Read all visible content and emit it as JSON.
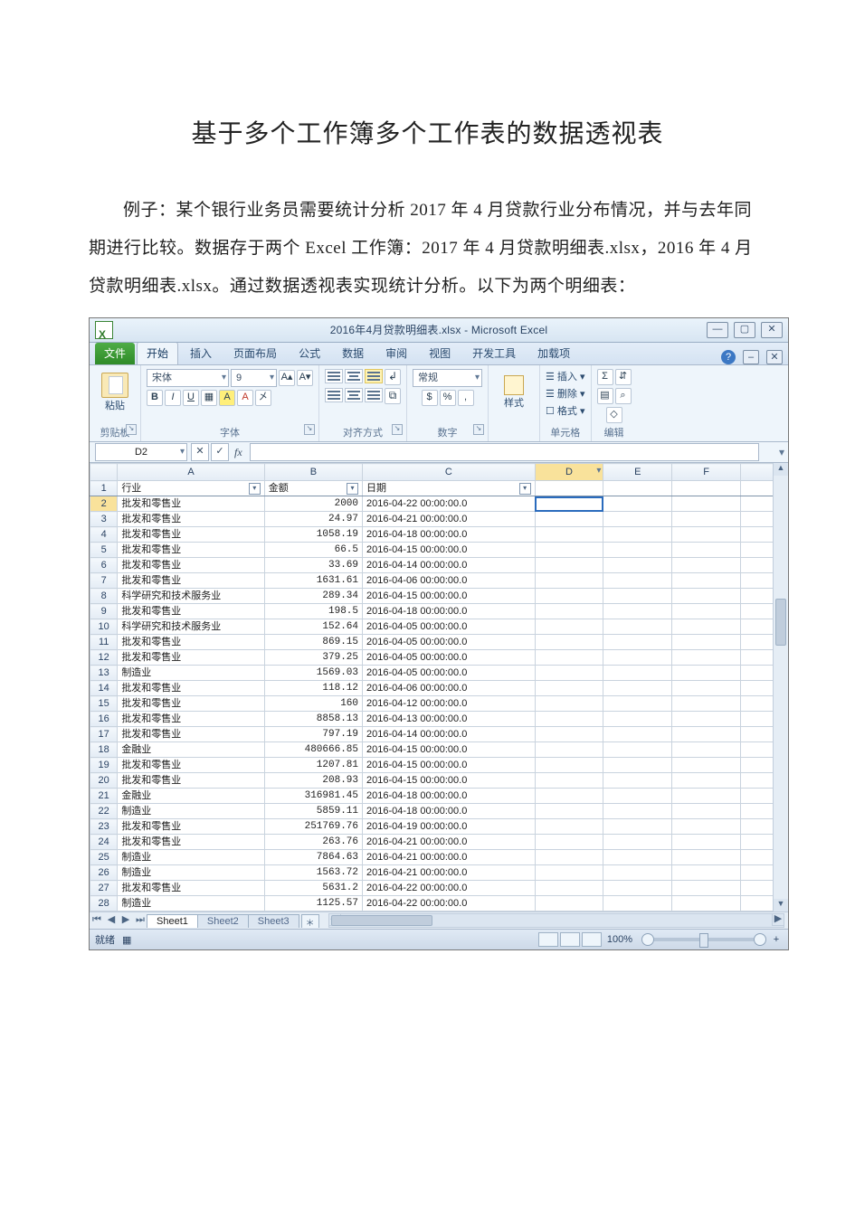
{
  "doc": {
    "title": "基于多个工作簿多个工作表的数据透视表",
    "para": "例子：某个银行业务员需要统计分析 2017 年 4 月贷款行业分布情况，并与去年同期进行比较。数据存于两个 Excel 工作簿：2017 年 4 月贷款明细表.xlsx，2016 年 4 月贷款明细表.xlsx。通过数据透视表实现统计分析。以下为两个明细表："
  },
  "excel": {
    "titlebar": "2016年4月贷款明细表.xlsx - Microsoft Excel",
    "winbtns": {
      "min": "—",
      "max": "▢",
      "close": "✕"
    },
    "tabs": {
      "file": "文件",
      "home": "开始",
      "insert": "插入",
      "layout": "页面布局",
      "formulas": "公式",
      "data": "数据",
      "review": "审阅",
      "view": "视图",
      "dev": "开发工具",
      "addins": "加载项"
    },
    "ribbon": {
      "clipboard": {
        "paste": "粘贴",
        "group": "剪贴板"
      },
      "font": {
        "name": "宋体",
        "size": "9",
        "bold": "B",
        "italic": "I",
        "underline": "U",
        "ruby": "㐅",
        "group": "字体"
      },
      "align": {
        "group": "对齐方式"
      },
      "number": {
        "format": "常规",
        "group": "数字"
      },
      "styles": {
        "label": "样式"
      },
      "cells": {
        "insert": "插入",
        "delete": "删除",
        "format": "格式",
        "group": "单元格"
      },
      "editing": {
        "sum": "Σ",
        "sort": "⇵",
        "find": "⌕",
        "group": "编辑"
      }
    },
    "formula": {
      "namebox": "D2",
      "fx": "fx"
    },
    "columns": [
      "A",
      "B",
      "C",
      "D",
      "E",
      "F"
    ],
    "headers": {
      "A": "行业",
      "B": "金额",
      "C": "日期"
    },
    "rows": [
      {
        "n": 2,
        "a": "批发和零售业",
        "b": "2000",
        "c": "2016-04-22 00:00:00.0"
      },
      {
        "n": 3,
        "a": "批发和零售业",
        "b": "24.97",
        "c": "2016-04-21 00:00:00.0"
      },
      {
        "n": 4,
        "a": "批发和零售业",
        "b": "1058.19",
        "c": "2016-04-18 00:00:00.0"
      },
      {
        "n": 5,
        "a": "批发和零售业",
        "b": "66.5",
        "c": "2016-04-15 00:00:00.0"
      },
      {
        "n": 6,
        "a": "批发和零售业",
        "b": "33.69",
        "c": "2016-04-14 00:00:00.0"
      },
      {
        "n": 7,
        "a": "批发和零售业",
        "b": "1631.61",
        "c": "2016-04-06 00:00:00.0"
      },
      {
        "n": 8,
        "a": "科学研究和技术服务业",
        "b": "289.34",
        "c": "2016-04-15 00:00:00.0"
      },
      {
        "n": 9,
        "a": "批发和零售业",
        "b": "198.5",
        "c": "2016-04-18 00:00:00.0"
      },
      {
        "n": 10,
        "a": "科学研究和技术服务业",
        "b": "152.64",
        "c": "2016-04-05 00:00:00.0"
      },
      {
        "n": 11,
        "a": "批发和零售业",
        "b": "869.15",
        "c": "2016-04-05 00:00:00.0"
      },
      {
        "n": 12,
        "a": "批发和零售业",
        "b": "379.25",
        "c": "2016-04-05 00:00:00.0"
      },
      {
        "n": 13,
        "a": "制造业",
        "b": "1569.03",
        "c": "2016-04-05 00:00:00.0"
      },
      {
        "n": 14,
        "a": "批发和零售业",
        "b": "118.12",
        "c": "2016-04-06 00:00:00.0"
      },
      {
        "n": 15,
        "a": "批发和零售业",
        "b": "160",
        "c": "2016-04-12 00:00:00.0"
      },
      {
        "n": 16,
        "a": "批发和零售业",
        "b": "8858.13",
        "c": "2016-04-13 00:00:00.0"
      },
      {
        "n": 17,
        "a": "批发和零售业",
        "b": "797.19",
        "c": "2016-04-14 00:00:00.0"
      },
      {
        "n": 18,
        "a": "金融业",
        "b": "480666.85",
        "c": "2016-04-15 00:00:00.0"
      },
      {
        "n": 19,
        "a": "批发和零售业",
        "b": "1207.81",
        "c": "2016-04-15 00:00:00.0"
      },
      {
        "n": 20,
        "a": "批发和零售业",
        "b": "208.93",
        "c": "2016-04-15 00:00:00.0"
      },
      {
        "n": 21,
        "a": "金融业",
        "b": "316981.45",
        "c": "2016-04-18 00:00:00.0"
      },
      {
        "n": 22,
        "a": "制造业",
        "b": "5859.11",
        "c": "2016-04-18 00:00:00.0"
      },
      {
        "n": 23,
        "a": "批发和零售业",
        "b": "251769.76",
        "c": "2016-04-19 00:00:00.0"
      },
      {
        "n": 24,
        "a": "批发和零售业",
        "b": "263.76",
        "c": "2016-04-21 00:00:00.0"
      },
      {
        "n": 25,
        "a": "制造业",
        "b": "7864.63",
        "c": "2016-04-21 00:00:00.0"
      },
      {
        "n": 26,
        "a": "制造业",
        "b": "1563.72",
        "c": "2016-04-21 00:00:00.0"
      },
      {
        "n": 27,
        "a": "批发和零售业",
        "b": "5631.2",
        "c": "2016-04-22 00:00:00.0"
      },
      {
        "n": 28,
        "a": "制造业",
        "b": "1125.57",
        "c": "2016-04-22 00:00:00.0"
      }
    ],
    "sheets": {
      "s1": "Sheet1",
      "s2": "Sheet2",
      "s3": "Sheet3"
    },
    "status": {
      "ready": "就绪",
      "ime": "▦",
      "zoom": "100%"
    }
  }
}
